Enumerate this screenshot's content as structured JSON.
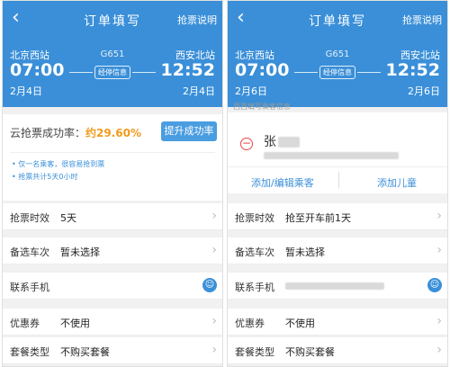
{
  "colors": {
    "primary": "#3a8fd8",
    "accent_orange": "#f29a1c",
    "danger": "#e44444"
  },
  "left": {
    "header": {
      "back_icon": "chevron-left-icon",
      "title": "订单填写",
      "help": "抢票说明"
    },
    "trip": {
      "from_station": "北京西站",
      "to_station": "西安北站",
      "train": "G651",
      "depart_time": "07:00",
      "arrive_time": "12:52",
      "depart_date": "2月4日",
      "arrive_date": "2月4日",
      "stop_info": "经停信息"
    },
    "rate": {
      "label": "云抢票成功率：",
      "value": "约29.60%",
      "upgrade_button": "提升成功率",
      "tip1": "• 仅一名乘客，很容易抢到票",
      "tip2": "• 抢票共计5天0小时"
    },
    "rows": [
      {
        "label": "抢票时效",
        "value": "5天",
        "icon": "chevron-right-icon"
      },
      {
        "label": "备选车次",
        "value": "暂未选择",
        "icon": "chevron-right-icon"
      },
      {
        "label": "联系手机",
        "value": "",
        "icon": "contact-icon"
      },
      {
        "label": "优惠券",
        "value": "不使用",
        "icon": "chevron-right-icon"
      },
      {
        "label": "套餐类型",
        "value": "不购买套餐",
        "icon": "chevron-right-icon"
      }
    ]
  },
  "right": {
    "header": {
      "back_icon": "chevron-left-icon",
      "title": "订单填写",
      "help": "抢票说明"
    },
    "trip": {
      "from_station": "北京西站",
      "to_station": "西安北站",
      "train": "G651",
      "depart_time": "07:00",
      "arrive_time": "12:52",
      "depart_date": "2月6日",
      "arrive_date": "2月6日",
      "stop_info": "经停信息"
    },
    "passenger": {
      "info_small": "西西填写乘客信息",
      "name": "张",
      "add_edit": "添加/编辑乘客",
      "add_child": "添加儿童",
      "remove_icon": "minus-circle-icon"
    },
    "rows": [
      {
        "label": "抢票时效",
        "value": "抢至开车前1天",
        "icon": "chevron-right-icon"
      },
      {
        "label": "备选车次",
        "value": "暂未选择",
        "icon": "chevron-right-icon"
      },
      {
        "label": "联系手机",
        "value": "",
        "icon": "contact-icon"
      },
      {
        "label": "优惠券",
        "value": "不使用",
        "icon": "chevron-right-icon"
      },
      {
        "label": "套餐类型",
        "value": "不购买套餐",
        "icon": "chevron-right-icon"
      }
    ]
  }
}
